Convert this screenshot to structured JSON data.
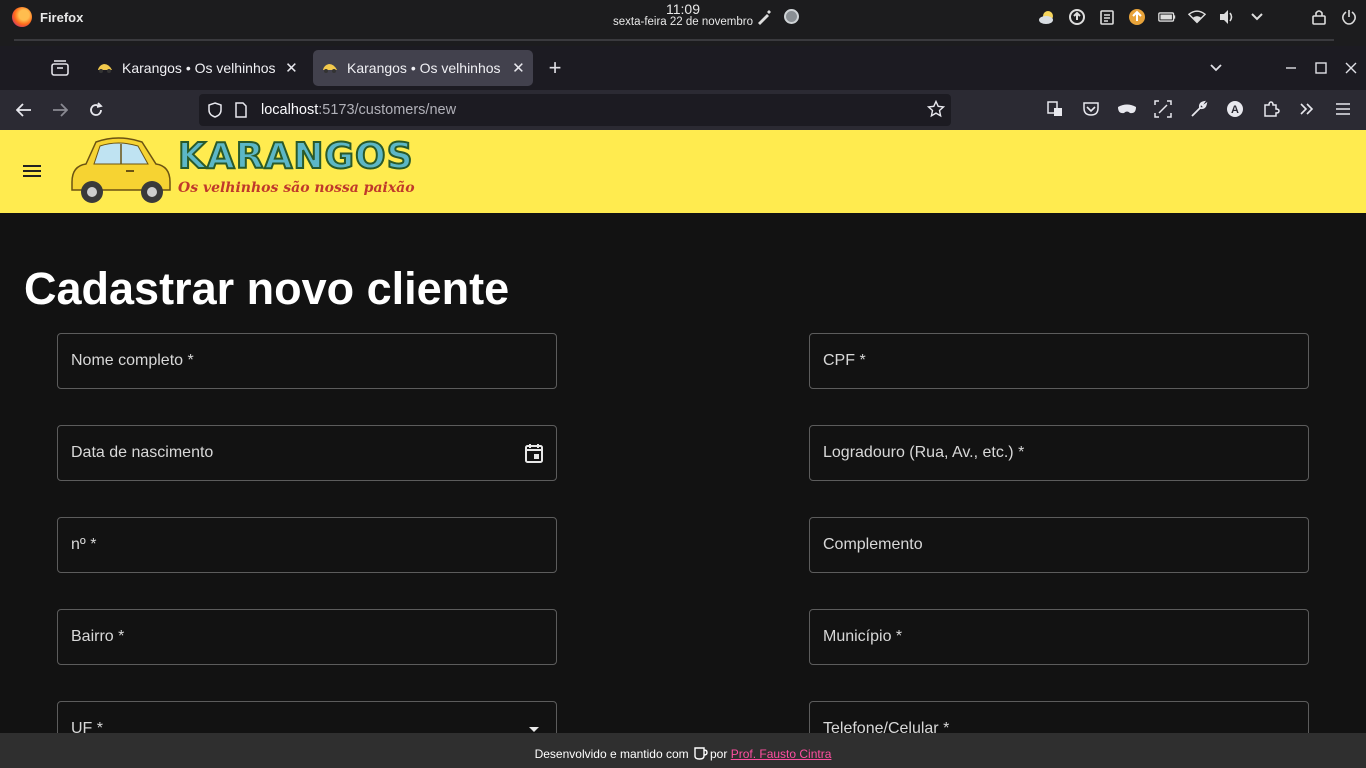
{
  "system": {
    "app_name": "Firefox",
    "time": "11:09",
    "date": "sexta-feira 22 de novembro"
  },
  "browser": {
    "tabs": [
      {
        "title": "Karangos • Os velhinhos são nossa paixão",
        "active": false
      },
      {
        "title": "Karangos • Os velhinhos são nossa paixão",
        "active": true
      }
    ],
    "url_host": "localhost",
    "url_path": ":5173/customers/new"
  },
  "app": {
    "logo_title": "KARANGOS",
    "logo_subtitle": "Os velhinhos são nossa paixão",
    "appbar_color": "#ffeb4f"
  },
  "page": {
    "title": "Cadastrar novo cliente",
    "fields": {
      "nome": "Nome completo *",
      "cpf": "CPF *",
      "nascimento": "Data de nascimento",
      "logradouro": "Logradouro (Rua, Av., etc.) *",
      "numero": "nº *",
      "complemento": "Complemento",
      "bairro": "Bairro *",
      "municipio": "Município *",
      "uf": "UF *",
      "telefone": "Telefone/Celular *"
    }
  },
  "footer": {
    "prefix": "Desenvolvido e mantido com",
    "by": "por",
    "author": "Prof. Fausto Cintra",
    "link_color": "#ff4fa1"
  }
}
